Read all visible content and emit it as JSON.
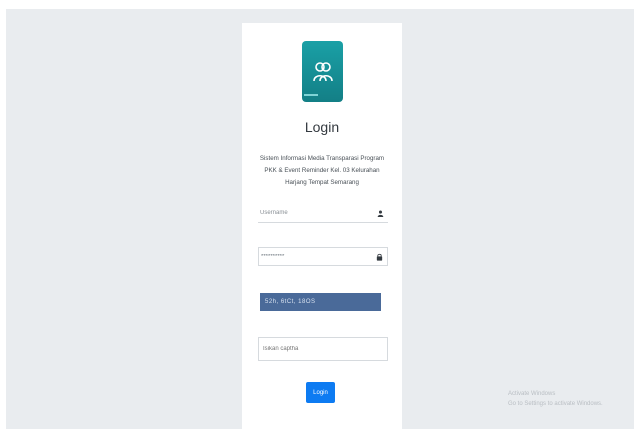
{
  "login": {
    "title": "Login",
    "description": "Sistem Informasi Media Transparasi Program PKK & Event Reminder Kel. 03 Kelurahan Harjang Tempat Semarang",
    "username_placeholder": "Username",
    "password_value": "**********",
    "captcha_text": "52h, 6tCt, 18OS",
    "captcha_input_placeholder": "Isikan captha",
    "button_label": "Login"
  },
  "watermark": {
    "line1": "Activate Windows",
    "line2": "Go to Settings to activate Windows."
  },
  "colors": {
    "logo": "#1aa0a6",
    "button": "#0d7bf2",
    "captcha_bg": "#4a6a99",
    "page_bg": "#e9ecef"
  },
  "icons": {
    "logo": "users-icon",
    "username": "user-icon",
    "password": "lock-icon"
  }
}
